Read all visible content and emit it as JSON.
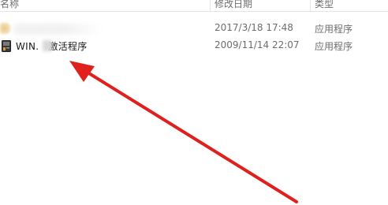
{
  "columns": {
    "name": "名称",
    "date": "修改日期",
    "type": "类型"
  },
  "rows": [
    {
      "name": "",
      "date": "2017/3/18 17:48",
      "type": "应用程序",
      "icon": "blurred-folder-icon"
    },
    {
      "name_prefix": "WIN.",
      "name_suffix": "激活程序",
      "date": "2009/11/14 22:07",
      "type": "应用程序",
      "icon": "app-icon"
    }
  ],
  "colors": {
    "arrow": "#e0201d",
    "header_text": "#6d6d6d",
    "name_text": "#1a1a1a"
  }
}
